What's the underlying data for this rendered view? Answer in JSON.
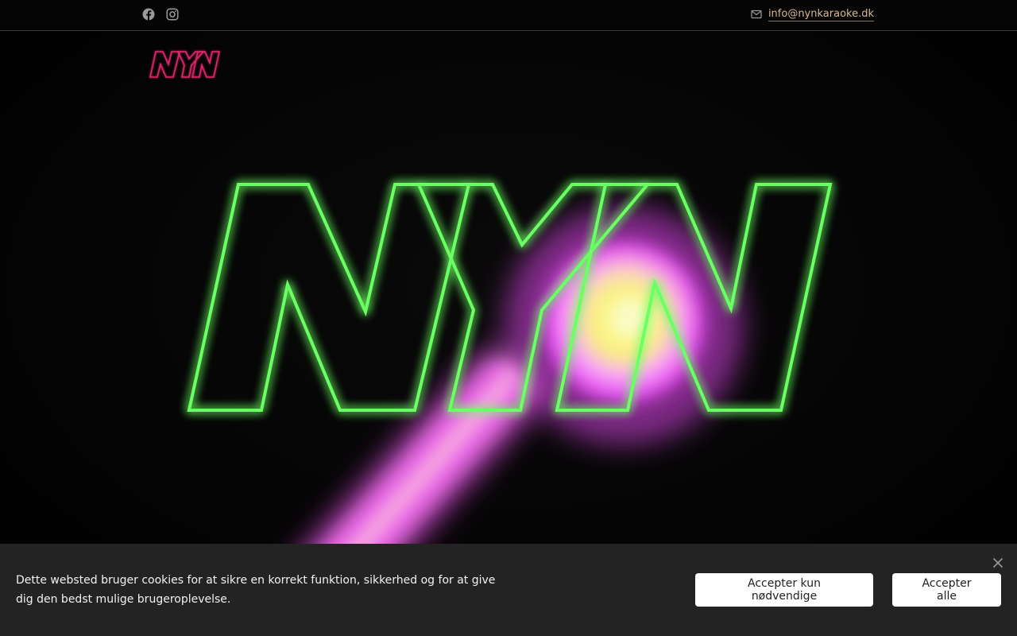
{
  "topbar": {
    "social": [
      {
        "icon": "facebook-icon"
      },
      {
        "icon": "instagram-icon"
      }
    ],
    "contact": {
      "icon": "mail-icon",
      "email": "info@nynkaraoke.dk"
    }
  },
  "brand": {
    "logo_text": "NYN",
    "logo_color": "#e0286a",
    "hero_outline_color": "#6bff62",
    "microphone_glow_color": "#ff4dff"
  },
  "cookie_banner": {
    "text": "Dette websted bruger cookies for at sikre en korrekt funktion, sikkerhed og for at give dig den bedst mulige brugeroplevelse.",
    "necessary_label": "Accepter kun nødvendige",
    "accept_all_label": "Accepter alle",
    "close_icon": "close-icon"
  }
}
